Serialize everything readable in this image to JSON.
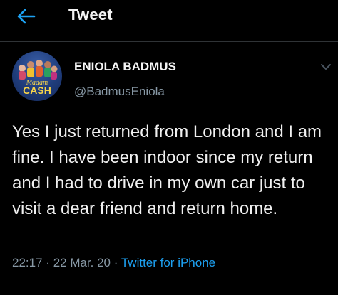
{
  "header": {
    "title": "Tweet",
    "back_icon": "arrow-left-icon",
    "accent_color": "#1da1f2"
  },
  "author": {
    "name": "ENIOLA BADMUS",
    "handle": "@BadmusEniola",
    "avatar_text_top": "Madam",
    "avatar_text_bottom": "CASH"
  },
  "tweet": {
    "text": "Yes I just returned from London and I am fine. I have been indoor since my return and I had to drive in my own car just to visit a dear friend and return home.",
    "time": "22:17",
    "date": "22 Mar. 20",
    "separator": "·",
    "source": "Twitter for iPhone"
  },
  "colors": {
    "background": "#000000",
    "muted": "#8899a6",
    "link": "#1da1f2"
  }
}
